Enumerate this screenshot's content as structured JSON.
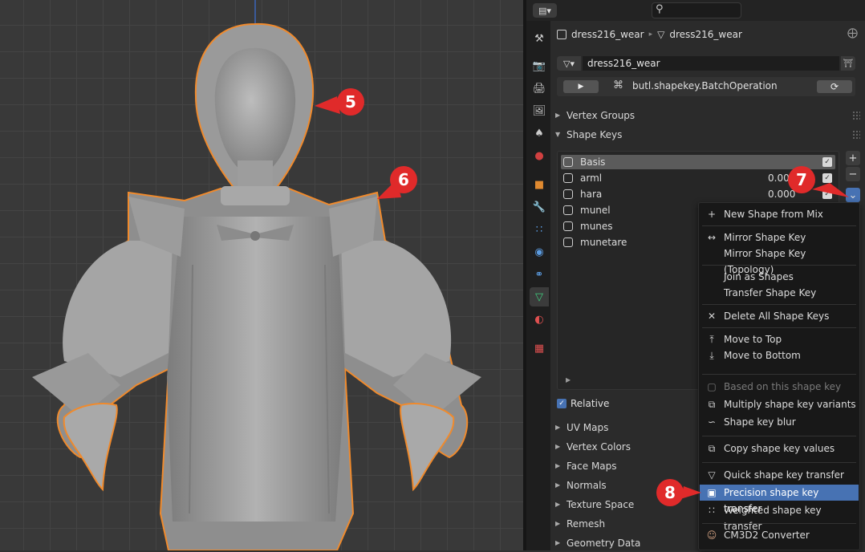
{
  "properties": {
    "breadcrumb": {
      "object": "dress216_wear",
      "data": "dress216_wear"
    },
    "mesh_name": "dress216_wear",
    "operator": "butl.shapekey.BatchOperation",
    "panels": {
      "vertex_groups": "Vertex Groups",
      "shape_keys": "Shape Keys",
      "relative": "Relative",
      "after": [
        "UV Maps",
        "Vertex Colors",
        "Face Maps",
        "Normals",
        "Texture Space",
        "Remesh",
        "Geometry Data"
      ]
    },
    "shape_keys": [
      {
        "name": "Basis",
        "value": ""
      },
      {
        "name": "arml",
        "value": "0.000"
      },
      {
        "name": "hara",
        "value": "0.000"
      },
      {
        "name": "munel",
        "value": ""
      },
      {
        "name": "munes",
        "value": ""
      },
      {
        "name": "munetare",
        "value": ""
      }
    ]
  },
  "menu": {
    "items": [
      {
        "icon": "plus-icon",
        "label": "New Shape from Mix"
      },
      {
        "icon": "mirror-arrow-icon",
        "label": "Mirror Shape Key"
      },
      {
        "icon": "",
        "label": "Mirror Shape Key (Topology)"
      },
      {
        "icon": "",
        "label": "Join as Shapes"
      },
      {
        "icon": "",
        "label": "Transfer Shape Key"
      },
      {
        "icon": "x-icon",
        "label": "Delete All Shape Keys"
      },
      {
        "icon": "move-top-icon",
        "label": "Move to Top"
      },
      {
        "icon": "move-bottom-icon",
        "label": "Move to Bottom"
      },
      {
        "icon": "",
        "label": "Based on this shape key"
      },
      {
        "icon": "multiply-icon",
        "label": "Multiply shape key variants"
      },
      {
        "icon": "blur-icon",
        "label": "Shape key blur"
      },
      {
        "icon": "copy-values-icon",
        "label": "Copy shape key values"
      },
      {
        "icon": "quick-transfer-icon",
        "label": "Quick shape key transfer"
      },
      {
        "icon": "precision-transfer-icon",
        "label": "Precision shape key transfer"
      },
      {
        "icon": "weighted-transfer-icon",
        "label": "Weighted shape key transfer"
      },
      {
        "icon": "cm3d2-icon",
        "label": "CM3D2 Converter"
      }
    ]
  },
  "callouts": [
    "5",
    "6",
    "7",
    "8"
  ],
  "colors": {
    "accent": "#4772b3",
    "selection_outline": "#f08a2c",
    "callout": "#e02a2a"
  }
}
